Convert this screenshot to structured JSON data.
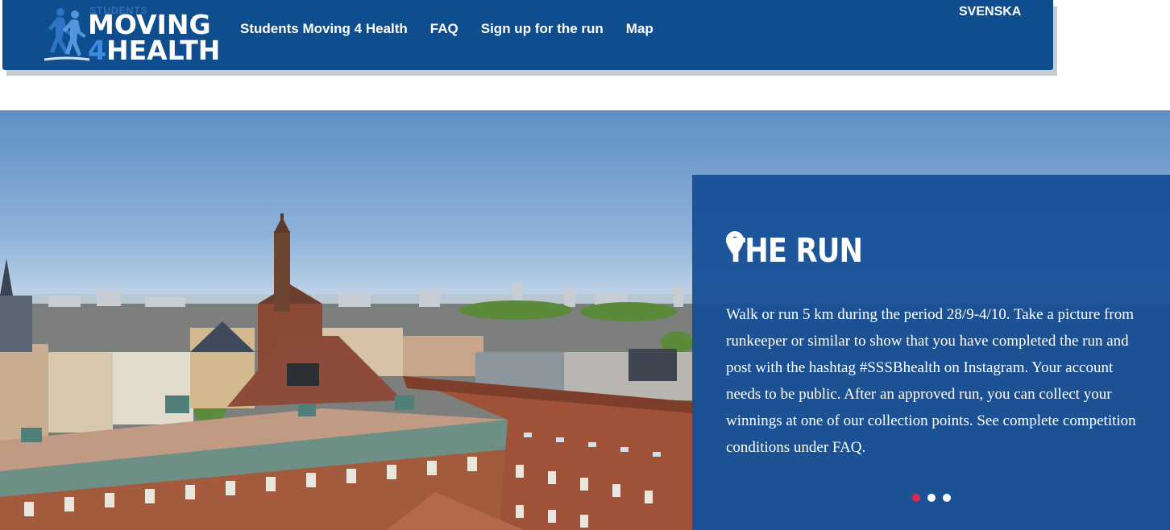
{
  "header": {
    "logo": {
      "small_text": "STUDENTS",
      "line1": "MOVING",
      "line2_number": "4",
      "line2_text": "HEALTH"
    },
    "nav": [
      {
        "label": "Students Moving 4 Health"
      },
      {
        "label": "FAQ"
      },
      {
        "label": "Sign up for the run"
      },
      {
        "label": "Map"
      }
    ],
    "language": "SVENSKA"
  },
  "hero": {
    "panel": {
      "icon": "map-pin-icon",
      "title": "THE RUN",
      "text": "Walk or run 5 km during the period 28/9-4/10. Take a picture from runkeeper or similar to show that you have completed the run and post with the hashtag #SSSBhealth on Instagram. Your account needs to be public. After an approved run, you can collect your winnings at one of our collection points. See complete competition conditions under FAQ."
    },
    "slider": {
      "slide_count": 3,
      "active_index": 0,
      "active_color": "#e3264d"
    }
  },
  "colors": {
    "header_bg": "#0e4d8e",
    "panel_bg": "#144e96",
    "accent": "#3b8be0"
  }
}
